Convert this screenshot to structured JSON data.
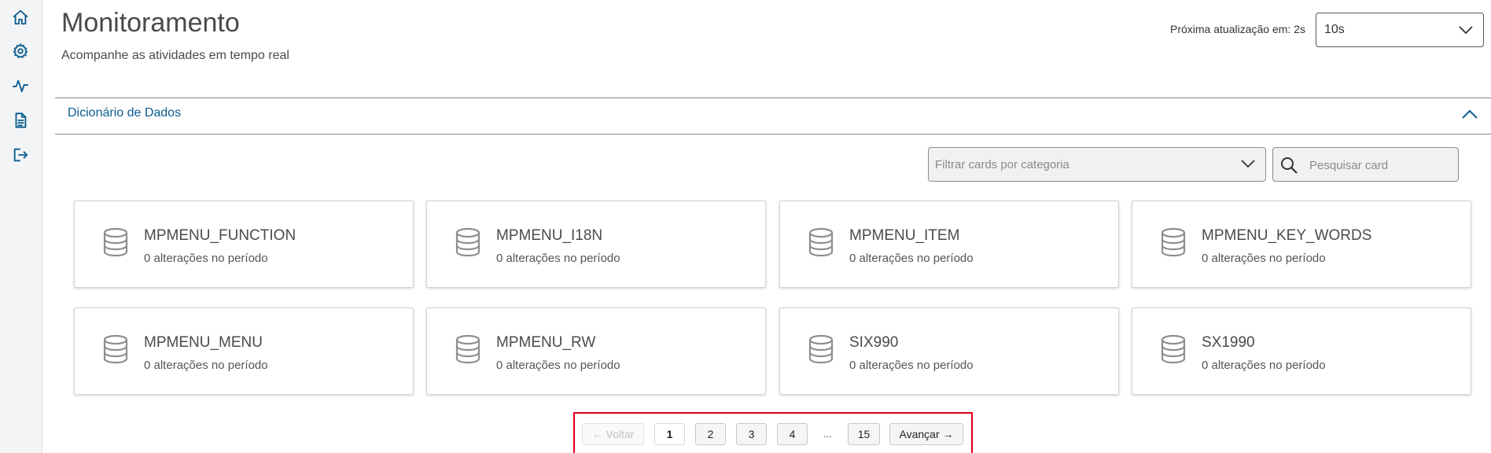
{
  "header": {
    "title": "Monitoramento",
    "subtitle": "Acompanhe as atividades em tempo real",
    "refresh_label": "Próxima atualização em: 2s",
    "refresh_value": "10s"
  },
  "sidebar": {
    "items": [
      {
        "icon": "home-icon"
      },
      {
        "icon": "gear-icon"
      },
      {
        "icon": "activity-icon"
      },
      {
        "icon": "document-icon"
      },
      {
        "icon": "logout-icon"
      }
    ]
  },
  "accordion": {
    "title": "Dicionário de Dados"
  },
  "filters": {
    "category_placeholder": "Filtrar cards por categoria",
    "search_placeholder": "Pesquisar card"
  },
  "cards": [
    {
      "name": "MPMENU_FUNCTION",
      "desc": "0 alterações no período"
    },
    {
      "name": "MPMENU_I18N",
      "desc": "0 alterações no período"
    },
    {
      "name": "MPMENU_ITEM",
      "desc": "0 alterações no período"
    },
    {
      "name": "MPMENU_KEY_WORDS",
      "desc": "0 alterações no período"
    },
    {
      "name": "MPMENU_MENU",
      "desc": "0 alterações no período"
    },
    {
      "name": "MPMENU_RW",
      "desc": "0 alterações no período"
    },
    {
      "name": "SIX990",
      "desc": "0 alterações no período"
    },
    {
      "name": "SX1990",
      "desc": "0 alterações no período"
    }
  ],
  "pagination": {
    "prev_label": "← Voltar",
    "pages": [
      "1",
      "2",
      "3",
      "4"
    ],
    "ellipsis": "...",
    "last_page": "15",
    "next_label": "Avançar →",
    "current_page": 1
  },
  "colors": {
    "accent": "#0b5c8e",
    "highlight_frame": "#e0001b"
  }
}
